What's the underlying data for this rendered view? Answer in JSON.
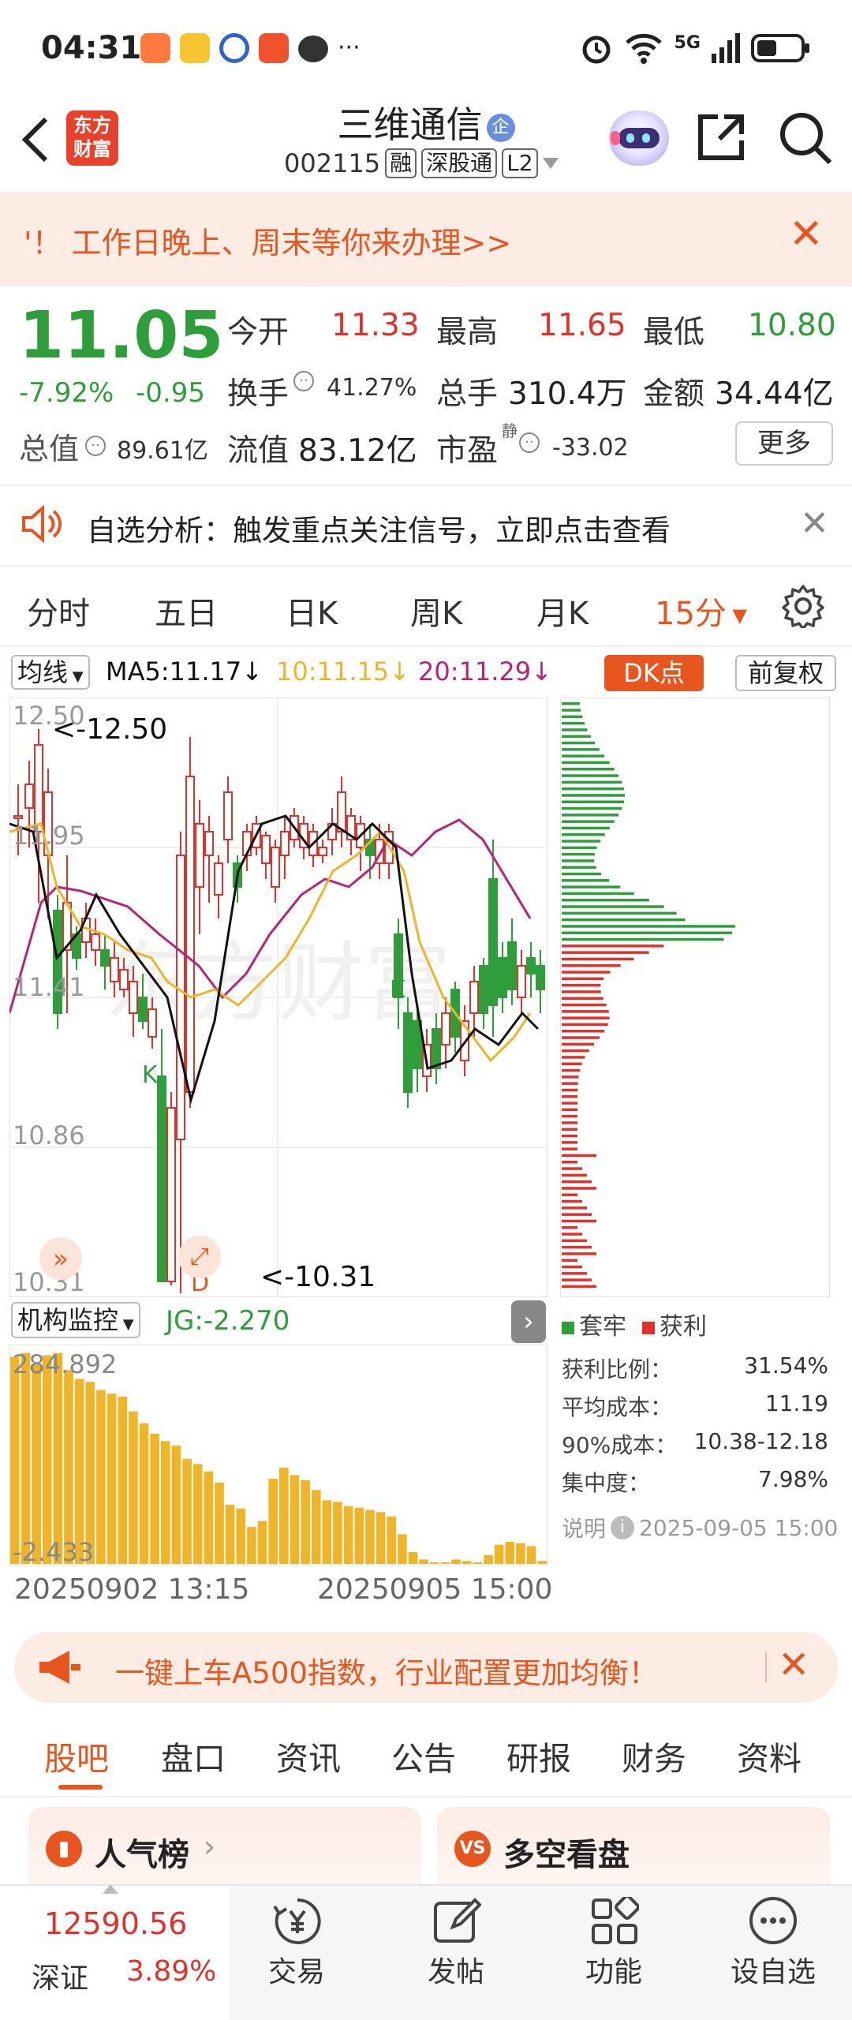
{
  "status_bar": {
    "time": "04:31",
    "network": "5G",
    "more": "···"
  },
  "header": {
    "app_logo_text": "东方\n财富",
    "stock_name": "三维通信",
    "badge": "企",
    "stock_code": "002115",
    "tags": [
      "融",
      "深股通",
      "L2"
    ]
  },
  "notice": {
    "text": "'！ 工作日晚上、周末等你来办理>>"
  },
  "quote": {
    "price": "11.05",
    "change_pct": "-7.92%",
    "change_amt": "-0.95",
    "open_label": "今开",
    "open": "11.33",
    "high_label": "最高",
    "high": "11.65",
    "low_label": "最低",
    "low": "10.80",
    "turnover_label": "换手",
    "turnover": "41.27%",
    "volume_label": "总手",
    "volume": "310.4万",
    "amount_label": "金额",
    "amount": "34.44亿",
    "mktcap_label": "总值",
    "mktcap": "89.61亿",
    "float_label": "流值",
    "float": "83.12亿",
    "pe_label": "市盈",
    "pe_sup": "静",
    "pe": "-33.02",
    "more_button": "更多"
  },
  "analysis_banner": {
    "text": "自选分析：触发重点关注信号，立即点击查看"
  },
  "period_tabs": [
    "分时",
    "五日",
    "日K",
    "周K",
    "月K",
    "15分"
  ],
  "ma_bar": {
    "selector": "均线",
    "ma5": "MA5:11.17",
    "ma10": "10:11.15",
    "ma20": "20:11.29",
    "dk_button": "DK点",
    "adjust_button": "前复权"
  },
  "kline": {
    "y_ticks": [
      "12.50",
      "11.95",
      "11.41",
      "10.86",
      "10.31"
    ],
    "high_marker": "<-12.50",
    "low_marker": "<-10.31",
    "k_marks": [
      "K",
      "K"
    ],
    "d_mark": "D",
    "colors": {
      "up": "#e0312b",
      "down": "#2e9e3a",
      "ma5": "#111111",
      "ma10": "#f0b429",
      "ma20": "#b8237a"
    }
  },
  "indicator": {
    "selector": "机构监控",
    "value": "JG:-2.270",
    "y_top": "284.892",
    "y_bottom": "-2.433",
    "bars": [
      280,
      285,
      270,
      282,
      285,
      262,
      250,
      246,
      235,
      230,
      226,
      206,
      190,
      176,
      166,
      160,
      142,
      135,
      125,
      110,
      80,
      75,
      50,
      58,
      115,
      130,
      120,
      113,
      100,
      86,
      84,
      78,
      76,
      73,
      70,
      64,
      40,
      16,
      6,
      0,
      2,
      6,
      4,
      2,
      12,
      26,
      30,
      28,
      24,
      4
    ]
  },
  "time_axis": {
    "start": "20250902 13:15",
    "end": "20250905 15:00"
  },
  "chips": {
    "legend_trapped": "套牢",
    "legend_profit": "获利",
    "profit_ratio_label": "获利比例：",
    "profit_ratio": "31.54%",
    "avg_cost_label": "平均成本：",
    "avg_cost": "11.19",
    "cost90_label": "90%成本：",
    "cost90": "10.38-12.18",
    "concentration_label": "集中度：",
    "concentration": "7.98%",
    "note_label": "说明",
    "note_time": "2025-09-05 15:00"
  },
  "promo": {
    "text": "一键上车A500指数，行业配置更加均衡！"
  },
  "bottom_tabs": [
    "股吧",
    "盘口",
    "资讯",
    "公告",
    "研报",
    "财务",
    "资料"
  ],
  "cards": {
    "popular": "人气榜",
    "longshort": "多空看盘"
  },
  "index_widget": {
    "value": "12590.56",
    "name": "深证",
    "change": "3.89%"
  },
  "nav": {
    "trade": "交易",
    "post": "发帖",
    "function": "功能",
    "watchlist": "设自选"
  }
}
